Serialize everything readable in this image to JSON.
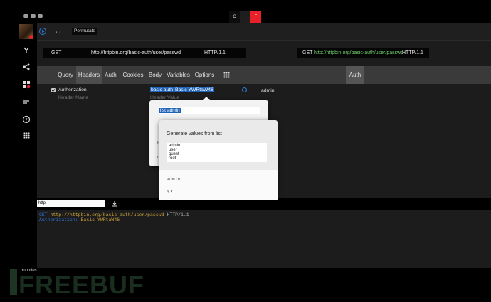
{
  "window": {
    "tabs": [
      "C",
      "I",
      "F"
    ],
    "active_tab": "F",
    "accent": "#e8202a"
  },
  "toolbar": {
    "mode_label": "Permutate"
  },
  "request": {
    "method": "GET",
    "url": "http://httpbin.org/basic-auth/user/passwd",
    "protocol": "HTTP/1.1"
  },
  "preview_request": {
    "method": "GET",
    "url": "http://httpbin.org/basic-auth/user/passwd",
    "protocol": "HTTP/1.1"
  },
  "tabs": [
    "Query",
    "Headers",
    "Auth",
    "Cookies",
    "Body",
    "Variables",
    "Options"
  ],
  "active_tab": "Headers",
  "right_panel": {
    "tab": "Auth",
    "value": "admin"
  },
  "headers": {
    "row1_name": "Authorization",
    "row1_value_hl1": "basic auth",
    "row1_value_hl2": "Basic YWRtaW46",
    "new_name_placeholder": "Header Name",
    "new_value_placeholder": "Header Value"
  },
  "popup1": {
    "input_hl1": "list",
    "input_hl2": "admin",
    "frag1": "B",
    "frag2": "r"
  },
  "popup2": {
    "title": "Generate values from list",
    "values": "admin\nuser\nguest\nroot",
    "preview": "admin",
    "nav": "‹ ›"
  },
  "search": {
    "value": "http"
  },
  "output": {
    "line1_method": "GET",
    "line1_url": "http://httpbin.org/basic-auth/user/passwd",
    "line1_proto": "HTTP/1.1",
    "line2_key": "Authorization:",
    "line2_val": "Basic YWRtaW46"
  },
  "watermark": {
    "label": "bounties",
    "brand": "FREEBUF"
  }
}
